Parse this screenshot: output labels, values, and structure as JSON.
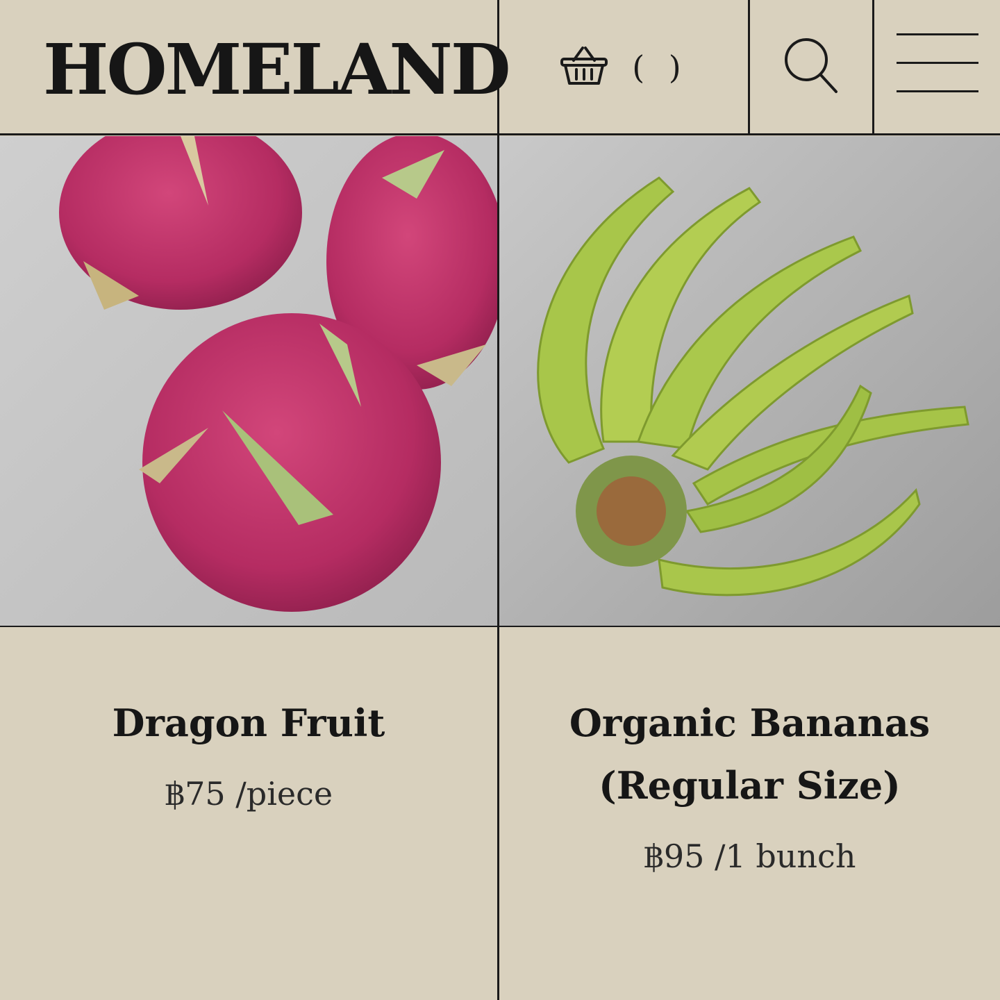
{
  "header": {
    "logo": "HOMELAND",
    "cart_count": "( )",
    "cart_icon": "basket-icon",
    "search_icon": "search-icon",
    "menu_icon": "hamburger-menu-icon"
  },
  "products": [
    {
      "name": "Dragon Fruit",
      "price": "฿75 /piece",
      "image": "dragon-fruit-photo"
    },
    {
      "name": "Organic Bananas (Regular Size)",
      "name_line1": "Organic Bananas",
      "name_line2": "(Regular Size)",
      "price": "฿95 /1 bunch",
      "image": "bananas-photo"
    }
  ],
  "colors": {
    "background": "#d9d1be",
    "line": "#1a1a1a",
    "text": "#161616"
  }
}
